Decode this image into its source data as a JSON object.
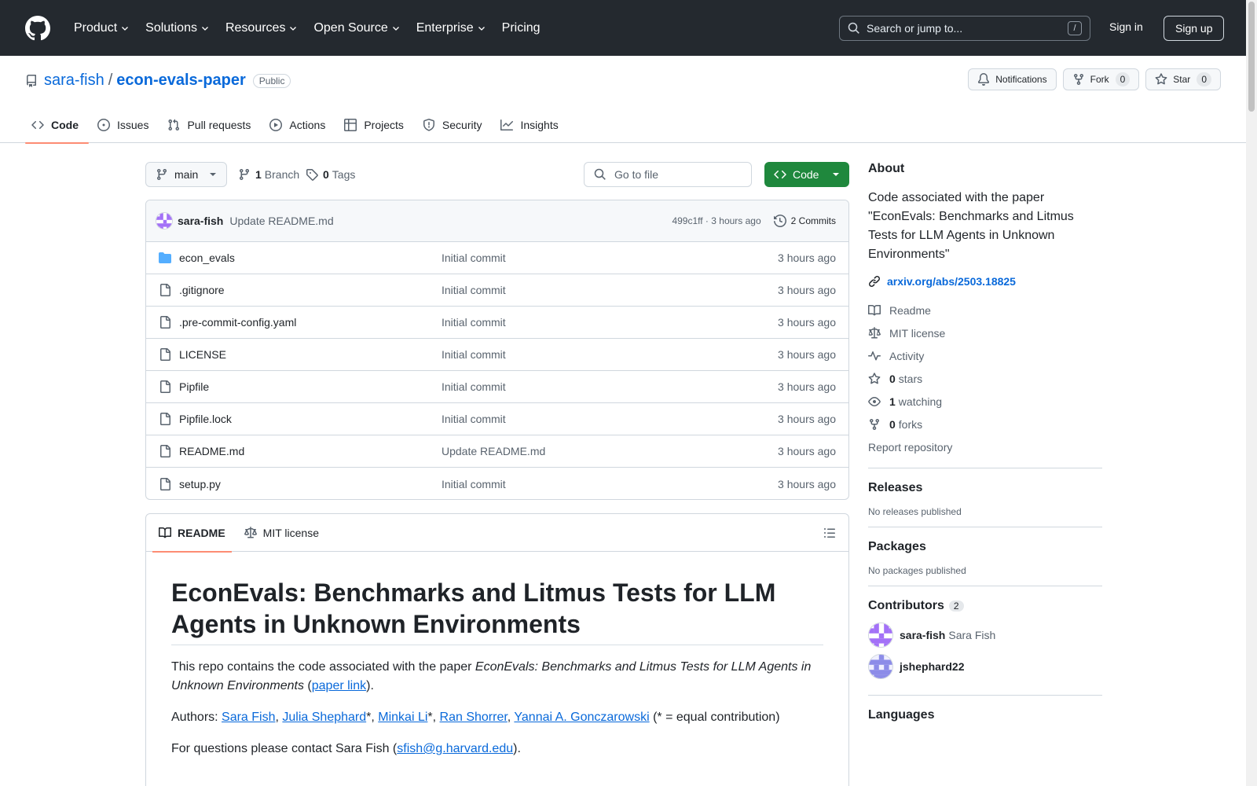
{
  "header": {
    "nav": [
      "Product",
      "Solutions",
      "Resources",
      "Open Source",
      "Enterprise",
      "Pricing"
    ],
    "search_placeholder": "Search or jump to...",
    "search_key": "/",
    "signin": "Sign in",
    "signup": "Sign up"
  },
  "repo": {
    "owner": "sara-fish",
    "separator": "/",
    "name": "econ-evals-paper",
    "visibility": "Public",
    "notifications": "Notifications",
    "fork_label": "Fork",
    "fork_count": "0",
    "star_label": "Star",
    "star_count": "0"
  },
  "tabs": [
    "Code",
    "Issues",
    "Pull requests",
    "Actions",
    "Projects",
    "Security",
    "Insights"
  ],
  "toolbar": {
    "branch": "main",
    "branch_count": "1",
    "branch_label": "Branch",
    "tag_count": "0",
    "tag_label": "Tags",
    "goto_placeholder": "Go to file",
    "code_label": "Code"
  },
  "commit": {
    "author": "sara-fish",
    "message": "Update README.md",
    "hash_time": "499c1ff · 3 hours ago",
    "commits": "2 Commits"
  },
  "files": [
    {
      "name": "econ_evals",
      "type": "dir",
      "message": "Initial commit",
      "time": "3 hours ago"
    },
    {
      "name": ".gitignore",
      "type": "file",
      "message": "Initial commit",
      "time": "3 hours ago"
    },
    {
      "name": ".pre-commit-config.yaml",
      "type": "file",
      "message": "Initial commit",
      "time": "3 hours ago"
    },
    {
      "name": "LICENSE",
      "type": "file",
      "message": "Initial commit",
      "time": "3 hours ago"
    },
    {
      "name": "Pipfile",
      "type": "file",
      "message": "Initial commit",
      "time": "3 hours ago"
    },
    {
      "name": "Pipfile.lock",
      "type": "file",
      "message": "Initial commit",
      "time": "3 hours ago"
    },
    {
      "name": "README.md",
      "type": "file",
      "message": "Update README.md",
      "time": "3 hours ago"
    },
    {
      "name": "setup.py",
      "type": "file",
      "message": "Initial commit",
      "time": "3 hours ago"
    }
  ],
  "readme": {
    "tab_readme": "README",
    "tab_license": "MIT license",
    "title": "EconEvals: Benchmarks and Litmus Tests for LLM Agents in Unknown Environments",
    "p1_pre": "This repo contains the code associated with the paper ",
    "p1_em": "EconEvals: Benchmarks and Litmus Tests for LLM Agents in Unknown Environments",
    "p1_open": " (",
    "p1_link": "paper link",
    "p1_close": ").",
    "authors_pre": "Authors: ",
    "authors": [
      "Sara Fish",
      "Julia Shephard",
      "Minkai Li",
      "Ran Shorrer",
      "Yannai A. Gonczarowski"
    ],
    "authors_suffix": " (* = equal contribution)",
    "contact_pre": "For questions please contact Sara Fish (",
    "contact_email": "sfish@g.harvard.edu",
    "contact_post": ")."
  },
  "about": {
    "heading": "About",
    "description": "Code associated with the paper \"EconEvals: Benchmarks and Litmus Tests for LLM Agents in Unknown Environments\"",
    "url": "arxiv.org/abs/2503.18825",
    "readme": "Readme",
    "license": "MIT license",
    "activity": "Activity",
    "stars_count": "0",
    "stars_label": "stars",
    "watching_count": "1",
    "watching_label": "watching",
    "forks_count": "0",
    "forks_label": "forks",
    "report": "Report repository"
  },
  "releases": {
    "heading": "Releases",
    "text": "No releases published"
  },
  "packages": {
    "heading": "Packages",
    "text": "No packages published"
  },
  "contributors": {
    "heading": "Contributors",
    "count": "2",
    "list": [
      {
        "login": "sara-fish",
        "name": "Sara Fish"
      },
      {
        "login": "jshephard22",
        "name": ""
      }
    ]
  },
  "languages": {
    "heading": "Languages"
  }
}
